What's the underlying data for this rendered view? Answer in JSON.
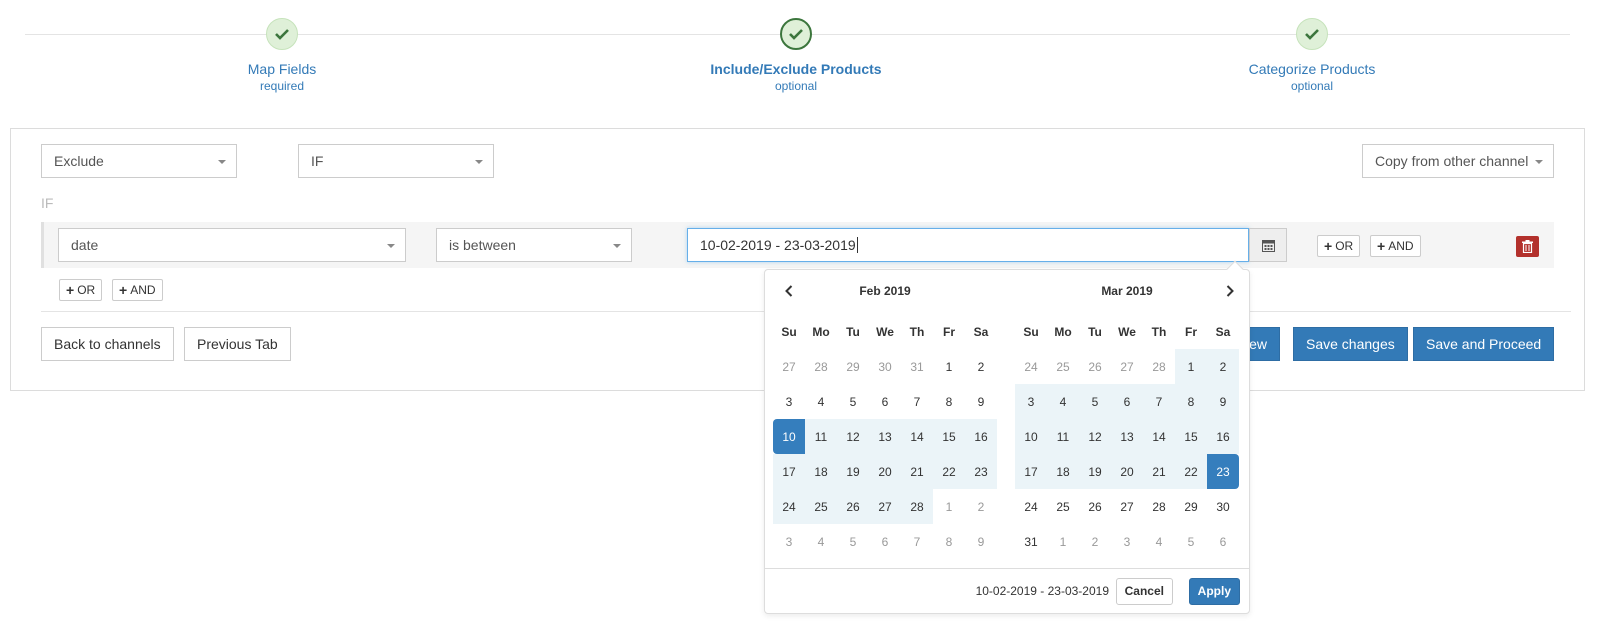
{
  "wizard": {
    "steps": [
      {
        "name": "Map Fields",
        "status": "required"
      },
      {
        "name": "Include/Exclude Products",
        "status": "optional"
      },
      {
        "name": "Categorize Products",
        "status": "optional"
      }
    ]
  },
  "filter": {
    "mode": "Exclude",
    "condition": "IF",
    "copy_label": "Copy from other channel",
    "if_label": "IF",
    "field": "date",
    "operator": "is between",
    "date_value": "10-02-2019 - 23-03-2019",
    "row_or": "OR",
    "row_and": "AND",
    "group_or": "OR",
    "group_and": "AND"
  },
  "actions": {
    "back": "Back to channels",
    "previous": "Previous Tab",
    "preview_partial": "view",
    "save": "Save changes",
    "proceed": "Save and Proceed"
  },
  "picker": {
    "dow": [
      "Su",
      "Mo",
      "Tu",
      "We",
      "Th",
      "Fr",
      "Sa"
    ],
    "left_month": "Feb 2019",
    "right_month": "Mar 2019",
    "left_days": [
      "27",
      "28",
      "29",
      "30",
      "31",
      "1",
      "2",
      "3",
      "4",
      "5",
      "6",
      "7",
      "8",
      "9",
      "10",
      "11",
      "12",
      "13",
      "14",
      "15",
      "16",
      "17",
      "18",
      "19",
      "20",
      "21",
      "22",
      "23",
      "24",
      "25",
      "26",
      "27",
      "28",
      "1",
      "2",
      "3",
      "4",
      "5",
      "6",
      "7",
      "8",
      "9"
    ],
    "right_days": [
      "24",
      "25",
      "26",
      "27",
      "28",
      "1",
      "2",
      "3",
      "4",
      "5",
      "6",
      "7",
      "8",
      "9",
      "10",
      "11",
      "12",
      "13",
      "14",
      "15",
      "16",
      "17",
      "18",
      "19",
      "20",
      "21",
      "22",
      "23",
      "24",
      "25",
      "26",
      "27",
      "28",
      "29",
      "30",
      "31",
      "1",
      "2",
      "3",
      "4",
      "5",
      "6"
    ],
    "selected_text": "10-02-2019 - 23-03-2019",
    "cancel": "Cancel",
    "apply": "Apply"
  },
  "colors": {
    "primary": "#337ab7",
    "success_bg": "#dff0d8",
    "success": "#3c763d",
    "range_bg": "#ebf4f8",
    "danger": "#b3312c"
  }
}
